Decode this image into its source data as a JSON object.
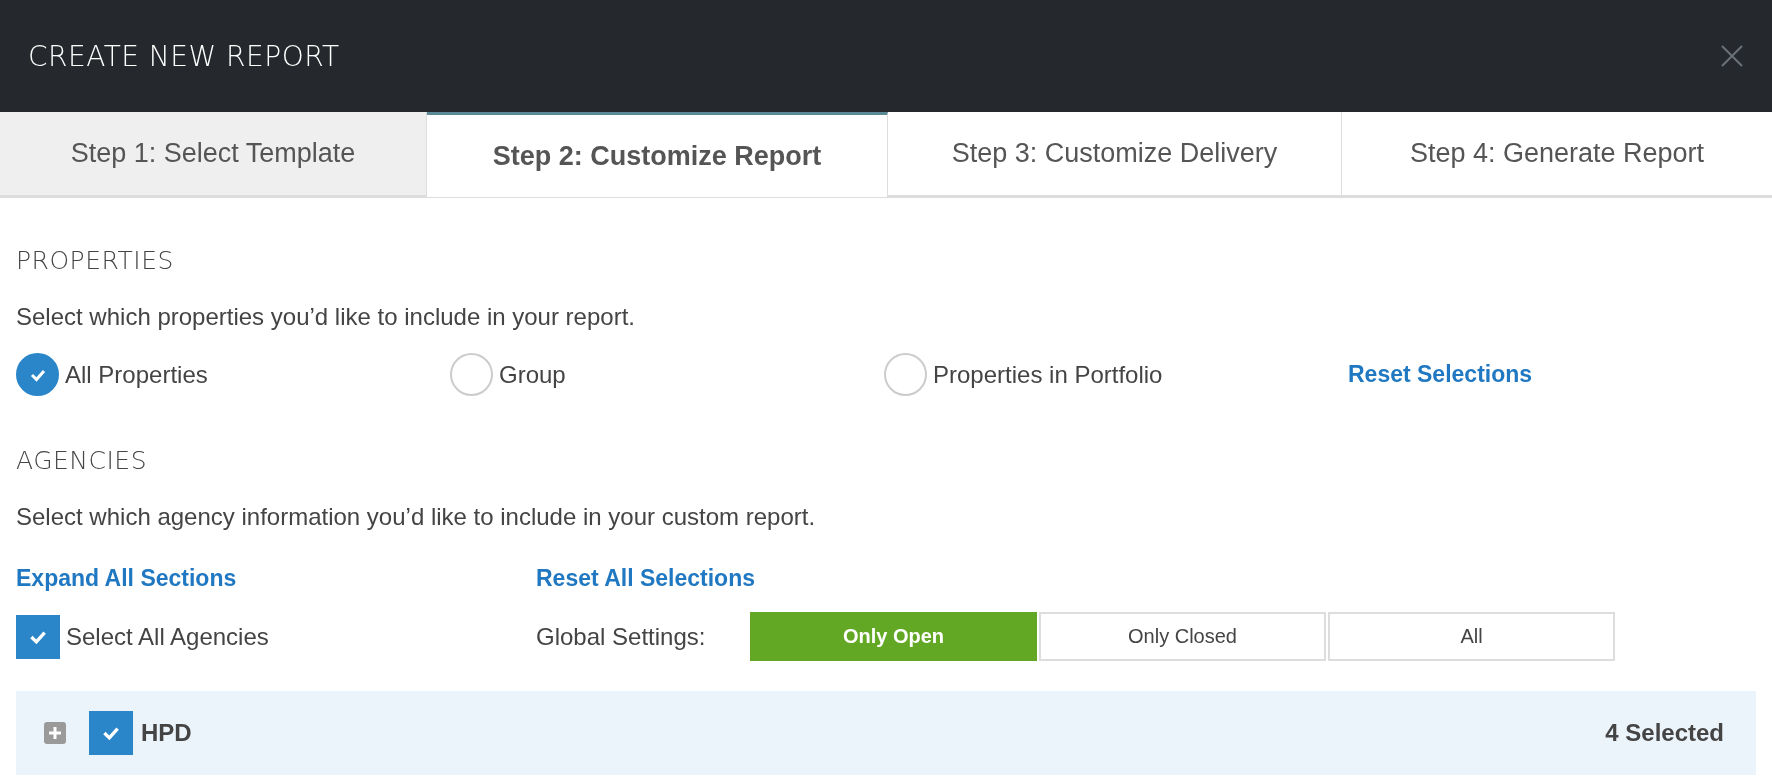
{
  "window": {
    "title": "CREATE NEW REPORT"
  },
  "tabs": [
    {
      "label": "Step 1: Select Template",
      "selected": false,
      "completed": true
    },
    {
      "label": "Step 2: Customize Report",
      "selected": true,
      "completed": false
    },
    {
      "label": "Step 3: Customize Delivery",
      "selected": false,
      "completed": false
    },
    {
      "label": "Step 4: Generate Report",
      "selected": false,
      "completed": false
    }
  ],
  "properties": {
    "heading": "PROPERTIES",
    "description": "Select which properties you’d like to include in your report.",
    "options": [
      {
        "label": "All Properties",
        "selected": true
      },
      {
        "label": "Group",
        "selected": false
      },
      {
        "label": "Properties in Portfolio",
        "selected": false
      }
    ],
    "reset_link": "Reset Selections"
  },
  "agencies": {
    "heading": "AGENCIES",
    "description": "Select which agency information you’d like to include in your custom report.",
    "expand_link": "Expand All Sections",
    "reset_link": "Reset All Selections",
    "select_all": {
      "label": "Select All Agencies",
      "checked": true
    },
    "global_settings_label": "Global Settings:",
    "global_settings": [
      {
        "label": "Only Open",
        "selected": true
      },
      {
        "label": "Only Closed",
        "selected": false
      },
      {
        "label": "All",
        "selected": false
      }
    ],
    "sections": [
      {
        "name": "HPD",
        "checked": true,
        "expanded": false,
        "count": "4 Selected"
      }
    ]
  }
}
